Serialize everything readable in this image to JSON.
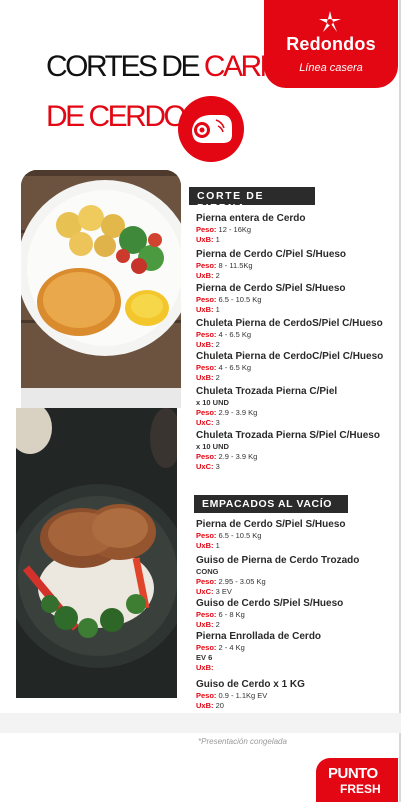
{
  "brand": {
    "name": "Redondos",
    "tagline": "Línea casera",
    "color": "#e30613"
  },
  "title": {
    "line1_black": "CORTES DE ",
    "line1_red": "CARNE",
    "line2": "DE CERDO"
  },
  "icons": {
    "brand_icon": "star-icon",
    "section_icon": "pig-icon"
  },
  "sections": [
    {
      "title": "CORTE DE PIERNA",
      "items": [
        {
          "name": "Pierna entera de Cerdo",
          "lines": [
            {
              "label": "Peso:",
              "value": "12 - 16Kg"
            },
            {
              "label": "UxB:",
              "value": "1"
            }
          ]
        },
        {
          "name": "Pierna de Cerdo C/Piel S/Hueso",
          "lines": [
            {
              "label": "Peso:",
              "value": "8 - 11.5Kg"
            },
            {
              "label": "UxB:",
              "value": "2"
            }
          ]
        },
        {
          "name": "Pierna de Cerdo S/Piel S/Hueso",
          "lines": [
            {
              "label": "Peso:",
              "value": "6.5 - 10.5 Kg"
            },
            {
              "label": "UxB:",
              "value": "1"
            }
          ]
        },
        {
          "name": "Chuleta Pierna de CerdoS/Piel C/Hueso",
          "lines": [
            {
              "label": "Peso:",
              "value": "4 - 6.5 Kg"
            },
            {
              "label": "UxB:",
              "value": "2"
            }
          ]
        },
        {
          "name": "Chuleta Pierna de CerdoC/Piel C/Hueso",
          "lines": [
            {
              "label": "Peso:",
              "value": "4 - 6.5 Kg"
            },
            {
              "label": "UxB:",
              "value": "2"
            }
          ]
        },
        {
          "name": "Chuleta Trozada Pierna C/Piel",
          "extra": "x 10 UND",
          "lines": [
            {
              "label": "Peso:",
              "value": "2.9 - 3.9 Kg"
            },
            {
              "label": "UxC:",
              "value": "3"
            }
          ]
        },
        {
          "name": "Chuleta Trozada Pierna S/Piel C/Hueso",
          "extra": "x 10 UND",
          "lines": [
            {
              "label": "Peso:",
              "value": "2.9 - 3.9 Kg"
            },
            {
              "label": "UxC:",
              "value": "3"
            }
          ]
        }
      ]
    },
    {
      "title": "EMPACADOS AL VACÍO",
      "items": [
        {
          "name": "Pierna de Cerdo S/Piel S/Hueso",
          "lines": [
            {
              "label": "Peso:",
              "value": "6.5 - 10.5 Kg"
            },
            {
              "label": "UxB:",
              "value": "1"
            }
          ]
        },
        {
          "name": "Guiso de Pierna de Cerdo Trozado",
          "extra": "CONG",
          "lines": [
            {
              "label": "Peso:",
              "value": "2.95 - 3.05 Kg"
            },
            {
              "label": "UxC:",
              "value": "3 EV"
            }
          ]
        },
        {
          "name": "Guiso de Cerdo S/Piel S/Hueso",
          "lines": [
            {
              "label": "Peso:",
              "value": "6 - 8 Kg"
            },
            {
              "label": "UxB:",
              "value": "2"
            }
          ]
        },
        {
          "name": "Pierna Enrollada de Cerdo",
          "lines": [
            {
              "label": "Peso:",
              "value": "2 - 4 Kg"
            },
            {
              "label": "",
              "value": "EV 6"
            },
            {
              "label": "UxB:",
              "value": ""
            }
          ]
        },
        {
          "name": "Guiso de Cerdo x 1 KG",
          "lines": [
            {
              "label": "Peso:",
              "value": "0.9 - 1.1Kg EV"
            },
            {
              "label": "UxB:",
              "value": "20"
            }
          ]
        }
      ]
    }
  ],
  "footnote": "*Presentación congelada",
  "footer_brand": {
    "line1": "PUNTO",
    "line2": "FRESH"
  }
}
